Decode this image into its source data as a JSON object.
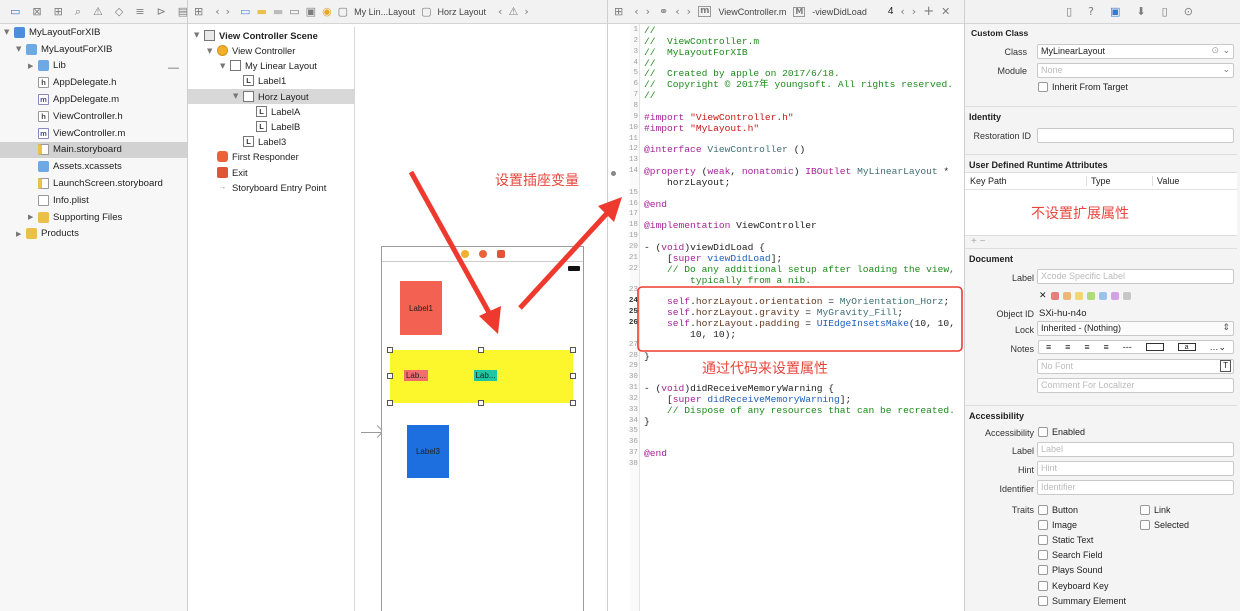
{
  "navigator": {
    "rows": [
      {
        "label": "MyLayoutForXIB",
        "icon": "project-icon",
        "indent": 0,
        "disc": "▼",
        "kind": "proj"
      },
      {
        "label": "MyLayoutForXIB",
        "icon": "folder-icon",
        "indent": 1,
        "disc": "▼",
        "kind": "fold"
      },
      {
        "label": "Lib",
        "icon": "folder-icon",
        "indent": 2,
        "disc": "▶",
        "kind": "fold"
      },
      {
        "label": "AppDelegate.h",
        "icon": "header-file-icon",
        "indent": 2,
        "disc": "",
        "kind": "h"
      },
      {
        "label": "AppDelegate.m",
        "icon": "impl-file-icon",
        "indent": 2,
        "disc": "",
        "kind": "m"
      },
      {
        "label": "ViewController.h",
        "icon": "header-file-icon",
        "indent": 2,
        "disc": "",
        "kind": "h"
      },
      {
        "label": "ViewController.m",
        "icon": "impl-file-icon",
        "indent": 2,
        "disc": "",
        "kind": "m"
      },
      {
        "label": "Main.storyboard",
        "icon": "storyboard-icon",
        "indent": 2,
        "disc": "",
        "kind": "sb",
        "selected": true
      },
      {
        "label": "Assets.xcassets",
        "icon": "assets-icon",
        "indent": 2,
        "disc": "",
        "kind": "fold"
      },
      {
        "label": "LaunchScreen.storyboard",
        "icon": "storyboard-icon",
        "indent": 2,
        "disc": "",
        "kind": "sb"
      },
      {
        "label": "Info.plist",
        "icon": "plist-icon",
        "indent": 2,
        "disc": "",
        "kind": "pl"
      },
      {
        "label": "Supporting Files",
        "icon": "folder-icon",
        "indent": 2,
        "disc": "▶",
        "kind": "foldy"
      },
      {
        "label": "Products",
        "icon": "folder-icon",
        "indent": 1,
        "disc": "▶",
        "kind": "foldy"
      }
    ]
  },
  "editor_bar": {
    "crumb_file": "My Lin...Layout",
    "crumb_item": "Horz Layout"
  },
  "outline": {
    "rows": [
      {
        "label": "View Controller Scene",
        "indent": 0,
        "disc": "▼",
        "icon": "scene-icon",
        "bold": true
      },
      {
        "label": "View Controller",
        "indent": 1,
        "disc": "▼",
        "icon": "view-controller-icon"
      },
      {
        "label": "My Linear Layout",
        "indent": 2,
        "disc": "▼",
        "icon": "view-icon"
      },
      {
        "label": "Label1",
        "indent": 3,
        "disc": "",
        "icon": "label-icon"
      },
      {
        "label": "Horz Layout",
        "indent": 3,
        "disc": "▼",
        "icon": "view-icon",
        "selected": true
      },
      {
        "label": "LabelA",
        "indent": 4,
        "disc": "",
        "icon": "label-icon"
      },
      {
        "label": "LabelB",
        "indent": 4,
        "disc": "",
        "icon": "label-icon"
      },
      {
        "label": "Label3",
        "indent": 3,
        "disc": "",
        "icon": "label-icon"
      },
      {
        "label": "First Responder",
        "indent": 1,
        "disc": "",
        "icon": "first-responder-icon"
      },
      {
        "label": "Exit",
        "indent": 1,
        "disc": "",
        "icon": "exit-icon"
      },
      {
        "label": "Storyboard Entry Point",
        "indent": 1,
        "disc": "",
        "icon": "entry-arrow-icon"
      }
    ]
  },
  "canvas": {
    "label1": "Label1",
    "labelA": "Lab...",
    "labelB": "Lab...",
    "label3": "Label3",
    "annotation_outlet": "设置插座变量",
    "annotation_code": "通过代码来设置属性"
  },
  "code_bar": {
    "file": "ViewController.m",
    "method": "-viewDidLoad",
    "count": "4"
  },
  "code": {
    "line_numbers": [
      "1",
      "2",
      "3",
      "4",
      "5",
      "6",
      "7",
      "8",
      "9",
      "10",
      "11",
      "12",
      "13",
      "14",
      "",
      "15",
      "16",
      "17",
      "18",
      "19",
      "20",
      "21",
      "22",
      "",
      "23",
      "24",
      "25",
      "26",
      "",
      "27",
      "28",
      "29",
      "30",
      "31",
      "32",
      "33",
      "34",
      "35",
      "36",
      "37",
      "38"
    ],
    "lines": [
      [
        [
          "cm",
          "//"
        ]
      ],
      [
        [
          "cm",
          "//  ViewController.m"
        ]
      ],
      [
        [
          "cm",
          "//  MyLayoutForXIB"
        ]
      ],
      [
        [
          "cm",
          "//"
        ]
      ],
      [
        [
          "cm",
          "//  Created by apple on 2017/6/18."
        ]
      ],
      [
        [
          "cm",
          "//  Copyright © 2017年 youngsoft. All rights reserved."
        ]
      ],
      [
        [
          "cm",
          "//"
        ]
      ],
      [],
      [
        [
          "kw",
          "#import "
        ],
        [
          "st",
          "\"ViewController.h\""
        ]
      ],
      [
        [
          "kw",
          "#import "
        ],
        [
          "st",
          "\"MyLayout.h\""
        ]
      ],
      [],
      [
        [
          "kw",
          "@interface "
        ],
        [
          "ty",
          "ViewController "
        ],
        [
          "",
          "()"
        ]
      ],
      [],
      [
        [
          "kw",
          "@property "
        ],
        [
          "",
          "("
        ],
        [
          "kw",
          "weak"
        ],
        [
          "",
          ", "
        ],
        [
          "kw",
          "nonatomic"
        ],
        [
          "",
          ") "
        ],
        [
          "kw",
          "IBOutlet "
        ],
        [
          "ty",
          "MyLinearLayout "
        ],
        [
          "",
          "*"
        ]
      ],
      [
        [
          "",
          "    horzLayout;"
        ]
      ],
      [],
      [
        [
          "kw",
          "@end"
        ]
      ],
      [],
      [
        [
          "kw",
          "@implementation "
        ],
        [
          "",
          "ViewController"
        ]
      ],
      [],
      [
        [
          "",
          "- ("
        ],
        [
          "kw",
          "void"
        ],
        [
          "",
          ")viewDidLoad {"
        ]
      ],
      [
        [
          "",
          "    ["
        ],
        [
          "kw",
          "super "
        ],
        [
          "me",
          "viewDidLoad"
        ],
        [
          "",
          "];"
        ]
      ],
      [
        [
          "cm",
          "    // Do any additional setup after loading the view,"
        ]
      ],
      [
        [
          "cm",
          "        typically from a nib."
        ]
      ],
      [],
      [
        [
          "",
          "    "
        ],
        [
          "kw",
          "self"
        ],
        [
          "",
          "."
        ],
        [
          "pr",
          "horzLayout"
        ],
        [
          "",
          "."
        ],
        [
          "pr",
          "orientation"
        ],
        [
          "",
          " = "
        ],
        [
          "ty",
          "MyOrientation_Horz"
        ],
        [
          "",
          ";"
        ]
      ],
      [
        [
          "",
          "    "
        ],
        [
          "kw",
          "self"
        ],
        [
          "",
          "."
        ],
        [
          "pr",
          "horzLayout"
        ],
        [
          "",
          "."
        ],
        [
          "pr",
          "gravity"
        ],
        [
          "",
          " = "
        ],
        [
          "ty",
          "MyGravity_Fill"
        ],
        [
          "",
          ";"
        ]
      ],
      [
        [
          "",
          "    "
        ],
        [
          "kw",
          "self"
        ],
        [
          "",
          "."
        ],
        [
          "pr",
          "horzLayout"
        ],
        [
          "",
          "."
        ],
        [
          "pr",
          "padding"
        ],
        [
          "",
          " = "
        ],
        [
          "me",
          "UIEdgeInsetsMake"
        ],
        [
          "",
          "(10, 10,"
        ]
      ],
      [
        [
          "",
          "        10, 10);"
        ]
      ],
      [],
      [
        [
          "",
          "}"
        ]
      ],
      [],
      [],
      [
        [
          "",
          "- ("
        ],
        [
          "kw",
          "void"
        ],
        [
          "",
          ")didReceiveMemoryWarning {"
        ]
      ],
      [
        [
          "",
          "    ["
        ],
        [
          "kw",
          "super "
        ],
        [
          "me",
          "didReceiveMemoryWarning"
        ],
        [
          "",
          "];"
        ]
      ],
      [
        [
          "cm",
          "    // Dispose of any resources that can be recreated."
        ]
      ],
      [
        [
          "",
          "}"
        ]
      ],
      [],
      [],
      [
        [
          "kw",
          "@end"
        ]
      ],
      []
    ]
  },
  "inspector": {
    "custom_class_title": "Custom Class",
    "class_label": "Class",
    "class_value": "MyLinearLayout",
    "module_label": "Module",
    "module_placeholder": "None",
    "inherit_label": "Inherit From Target",
    "identity_title": "Identity",
    "restoration_label": "Restoration ID",
    "runtime_title": "User Defined Runtime Attributes",
    "col_key": "Key Path",
    "col_type": "Type",
    "col_value": "Value",
    "runtime_note": "不设置扩展属性",
    "add_remove": "+ −",
    "document_title": "Document",
    "doc_label_label": "Label",
    "doc_label_placeholder": "Xcode Specific Label",
    "object_id_label": "Object ID",
    "object_id_value": "SXi-hu-n4o",
    "lock_label": "Lock",
    "lock_value": "Inherited - (Nothing)",
    "notes_label": "Notes",
    "no_font": "No Font",
    "comment_placeholder": "Comment For Localizer",
    "accessibility_title": "Accessibility",
    "acc_label": "Accessibility",
    "acc_enabled": "Enabled",
    "acc_label_label": "Label",
    "acc_label_placeholder": "Label",
    "hint_label": "Hint",
    "hint_placeholder": "Hint",
    "identifier_label": "Identifier",
    "identifier_placeholder": "Identifier",
    "traits_label": "Traits",
    "traits_left": [
      "Button",
      "Image",
      "Static Text",
      "Search Field",
      "Plays Sound",
      "Keyboard Key",
      "Summary Element"
    ],
    "traits_right": [
      "Link",
      "Selected"
    ],
    "label_colors": [
      "#e05a4f",
      "#f0a24a",
      "#f1cf48",
      "#9bd14f",
      "#7cb3ea",
      "#c887de",
      "#b8b8b8"
    ]
  }
}
